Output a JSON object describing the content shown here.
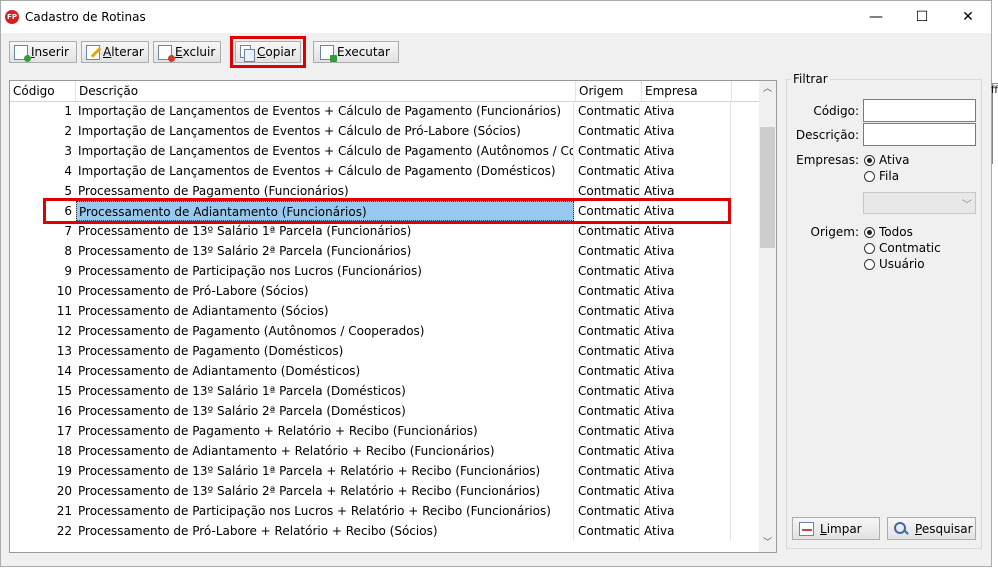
{
  "window": {
    "title": "Cadastro de Rotinas",
    "app_icon_text": "FP",
    "minimize_glyph": "—",
    "maximize_glyph": "☐",
    "close_glyph": "✕"
  },
  "toolbar": {
    "buttons": [
      {
        "label": "Inserir",
        "accel": "I",
        "rest": "nserir",
        "icon": "insert-doc-icon"
      },
      {
        "label": "Alterar",
        "accel": "A",
        "rest": "lterar",
        "icon": "edit-doc-icon"
      },
      {
        "label": "Excluir",
        "accel": "E",
        "rest": "xcluir",
        "icon": "delete-doc-icon"
      },
      {
        "label": "Copiar",
        "accel": "C",
        "rest": "opiar",
        "icon": "copy-icon"
      },
      {
        "label": "Executar",
        "accel": "",
        "rest": "Executar",
        "icon": "execute-icon"
      }
    ]
  },
  "grid": {
    "columns": [
      "Código",
      "Descrição",
      "Origem",
      "Empresa"
    ],
    "selected_codigo": "6",
    "rows": [
      {
        "codigo": "1",
        "descricao": "Importação de Lançamentos de Eventos + Cálculo de Pagamento (Funcionários)",
        "origem": "Contmatic",
        "empresa": "Ativa"
      },
      {
        "codigo": "2",
        "descricao": "Importação de Lançamentos de Eventos + Cálculo de Pró-Labore (Sócios)",
        "origem": "Contmatic",
        "empresa": "Ativa"
      },
      {
        "codigo": "3",
        "descricao": "Importação de Lançamentos de Eventos + Cálculo de Pagamento (Autônomos / Cooperados)",
        "origem": "Contmatic",
        "empresa": "Ativa"
      },
      {
        "codigo": "4",
        "descricao": "Importação de Lançamentos de Eventos + Cálculo de Pagamento (Domésticos)",
        "origem": "Contmatic",
        "empresa": "Ativa"
      },
      {
        "codigo": "5",
        "descricao": "Processamento de Pagamento (Funcionários)",
        "origem": "Contmatic",
        "empresa": "Ativa"
      },
      {
        "codigo": "6",
        "descricao": "Processamento de Adiantamento (Funcionários)",
        "origem": "Contmatic",
        "empresa": "Ativa"
      },
      {
        "codigo": "7",
        "descricao": "Processamento de 13º Salário 1ª Parcela (Funcionários)",
        "origem": "Contmatic",
        "empresa": "Ativa"
      },
      {
        "codigo": "8",
        "descricao": "Processamento de 13º Salário 2ª Parcela (Funcionários)",
        "origem": "Contmatic",
        "empresa": "Ativa"
      },
      {
        "codigo": "9",
        "descricao": "Processamento de Participação nos Lucros (Funcionários)",
        "origem": "Contmatic",
        "empresa": "Ativa"
      },
      {
        "codigo": "10",
        "descricao": "Processamento de Pró-Labore (Sócios)",
        "origem": "Contmatic",
        "empresa": "Ativa"
      },
      {
        "codigo": "11",
        "descricao": "Processamento de Adiantamento (Sócios)",
        "origem": "Contmatic",
        "empresa": "Ativa"
      },
      {
        "codigo": "12",
        "descricao": "Processamento de Pagamento (Autônomos / Cooperados)",
        "origem": "Contmatic",
        "empresa": "Ativa"
      },
      {
        "codigo": "13",
        "descricao": "Processamento de Pagamento (Domésticos)",
        "origem": "Contmatic",
        "empresa": "Ativa"
      },
      {
        "codigo": "14",
        "descricao": "Processamento de Adiantamento (Domésticos)",
        "origem": "Contmatic",
        "empresa": "Ativa"
      },
      {
        "codigo": "15",
        "descricao": "Processamento de 13º Salário 1ª Parcela (Domésticos)",
        "origem": "Contmatic",
        "empresa": "Ativa"
      },
      {
        "codigo": "16",
        "descricao": "Processamento de 13º Salário 2ª Parcela (Domésticos)",
        "origem": "Contmatic",
        "empresa": "Ativa"
      },
      {
        "codigo": "17",
        "descricao": "Processamento de Pagamento + Relatório + Recibo (Funcionários)",
        "origem": "Contmatic",
        "empresa": "Ativa"
      },
      {
        "codigo": "18",
        "descricao": "Processamento de Adiantamento + Relatório + Recibo (Funcionários)",
        "origem": "Contmatic",
        "empresa": "Ativa"
      },
      {
        "codigo": "19",
        "descricao": "Processamento de 13º Salário 1ª Parcela + Relatório + Recibo (Funcionários)",
        "origem": "Contmatic",
        "empresa": "Ativa"
      },
      {
        "codigo": "20",
        "descricao": "Processamento de 13º Salário 2ª Parcela + Relatório + Recibo (Funcionários)",
        "origem": "Contmatic",
        "empresa": "Ativa"
      },
      {
        "codigo": "21",
        "descricao": "Processamento de Participação nos Lucros + Relatório + Recibo (Funcionários)",
        "origem": "Contmatic",
        "empresa": "Ativa"
      },
      {
        "codigo": "22",
        "descricao": "Processamento de Pró-Labore + Relatório + Recibo (Sócios)",
        "origem": "Contmatic",
        "empresa": "Ativa"
      }
    ]
  },
  "filter": {
    "title": "Filtrar",
    "codigo_label": "Código:",
    "codigo_value": "",
    "descricao_label": "Descrição:",
    "descricao_value": "",
    "empresas_label": "Empresas:",
    "empresas_options": [
      {
        "label": "Ativa",
        "checked": true
      },
      {
        "label": "Fila",
        "checked": false
      }
    ],
    "combo_value": "",
    "origem_label": "Origem:",
    "origem_options": [
      {
        "label": "Todos",
        "checked": true
      },
      {
        "label": "Contmatic",
        "checked": false
      },
      {
        "label": "Usuário",
        "checked": false
      }
    ],
    "limpar": {
      "accel": "L",
      "rest": "impar"
    },
    "pesquisar": {
      "accel": "P",
      "rest": "esquisar"
    }
  },
  "partial_edge_text": "ff",
  "highlight_color": "#e00000",
  "selection_color": "#99c9ef"
}
